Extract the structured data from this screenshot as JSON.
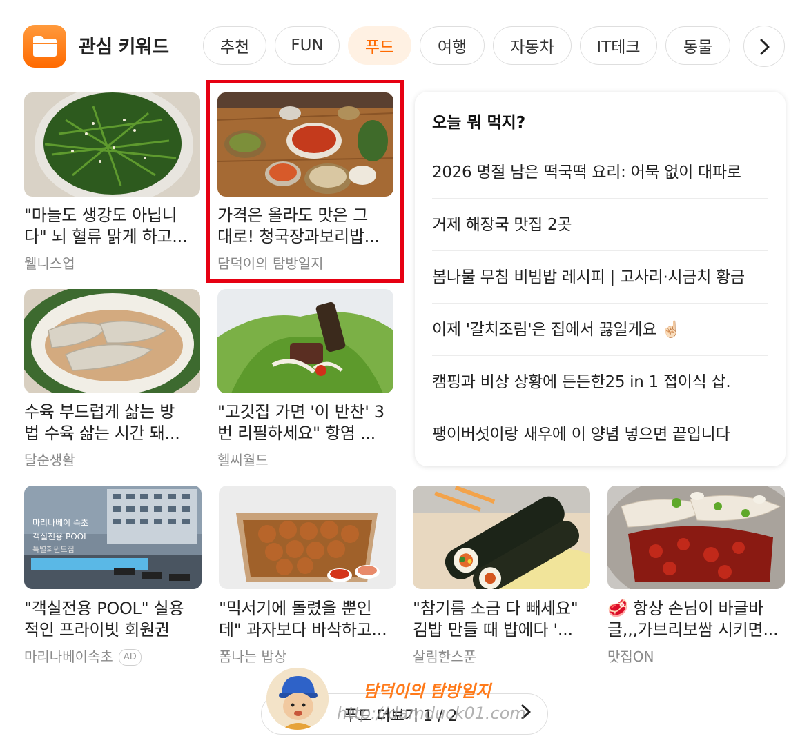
{
  "header": {
    "title": "관심 키워드",
    "tabs": [
      {
        "label": "추천",
        "active": false
      },
      {
        "label": "FUN",
        "active": false
      },
      {
        "label": "푸드",
        "active": true
      },
      {
        "label": "여행",
        "active": false
      },
      {
        "label": "자동차",
        "active": false
      },
      {
        "label": "IT테크",
        "active": false
      },
      {
        "label": "동물",
        "active": false
      }
    ],
    "next_icon": "chevron-right-icon"
  },
  "grid_cards": [
    {
      "title": "\"마늘도 생강도 아닙니다\" 뇌 혈류 맑게 하고...",
      "title_lines": [
        "\"마늘도 생강도 아닙니",
        "다\" 뇌 혈류 맑게 하고..."
      ],
      "source": "웰니스업"
    },
    {
      "title": "가격은 올라도 맛은 그대로! 청국장과보리밥...",
      "title_lines": [
        "가격은 올라도 맛은 그",
        "대로! 청국장과보리밥..."
      ],
      "source": "담덕이의 탐방일지",
      "highlighted": true
    },
    {
      "title": "수육 부드럽게 삶는 방법 수육 삶는 시간 돼...",
      "title_lines": [
        "수육 부드럽게 삶는 방",
        "법 수육 삶는 시간 돼..."
      ],
      "source": "달순생활"
    },
    {
      "title": "\"고깃집 가면 '이 반찬' 3번 리필하세요\" 항염 ...",
      "title_lines": [
        "\"고깃집 가면 '이 반찬' 3",
        "번 리필하세요\" 항염 ..."
      ],
      "source": "헬씨월드"
    }
  ],
  "panel": {
    "title": "오늘 뭐 먹지?",
    "items": [
      "2026 명절 남은 떡국떡 요리: 어묵 없이 대파로",
      "거제 해장국 맛집 2곳",
      "봄나물 무침 비빔밥 레시피 | 고사리·시금치 황금",
      "이제 '갈치조림'은 집에서 끓일게요 ☝🏻",
      "캠핑과 비상 상황에 든든한25 in 1 접이식 삽.",
      "팽이버섯이랑 새우에 이 양념 넣으면 끝입니다"
    ]
  },
  "bottom_cards": [
    {
      "title_lines": [
        "\"객실전용 POOL\" 실용",
        "적인 프라이빗 회원권"
      ],
      "source": "마리나베이속초",
      "ad_badge": "AD",
      "thumb_text": [
        "마리나베이 속초",
        "객실전용 POOL",
        "특별회원모집"
      ]
    },
    {
      "title_lines": [
        "\"믹서기에 돌렸을 뿐인",
        "데\" 과자보다 바삭하고..."
      ],
      "source": "폼나는 밥상"
    },
    {
      "title_lines": [
        "\"참기름 소금 다 빼세요\"",
        "김밥 만들 때 밥에다 '..."
      ],
      "source": "살림한스푼"
    },
    {
      "title_lines": [
        "🥩 항상 손님이 바글바",
        "글,,,가브리보쌈 시키면..."
      ],
      "source": "맛집ON"
    }
  ],
  "footer": {
    "more_label": "푸드 더보기 1 / 2",
    "watermark_title": "담덕이의 탐방일지",
    "watermark_url": "http://damduck01.com"
  },
  "colors": {
    "accent": "#ff6a00",
    "active_tab_bg": "#fff1e3",
    "highlight_box": "#e60012"
  }
}
